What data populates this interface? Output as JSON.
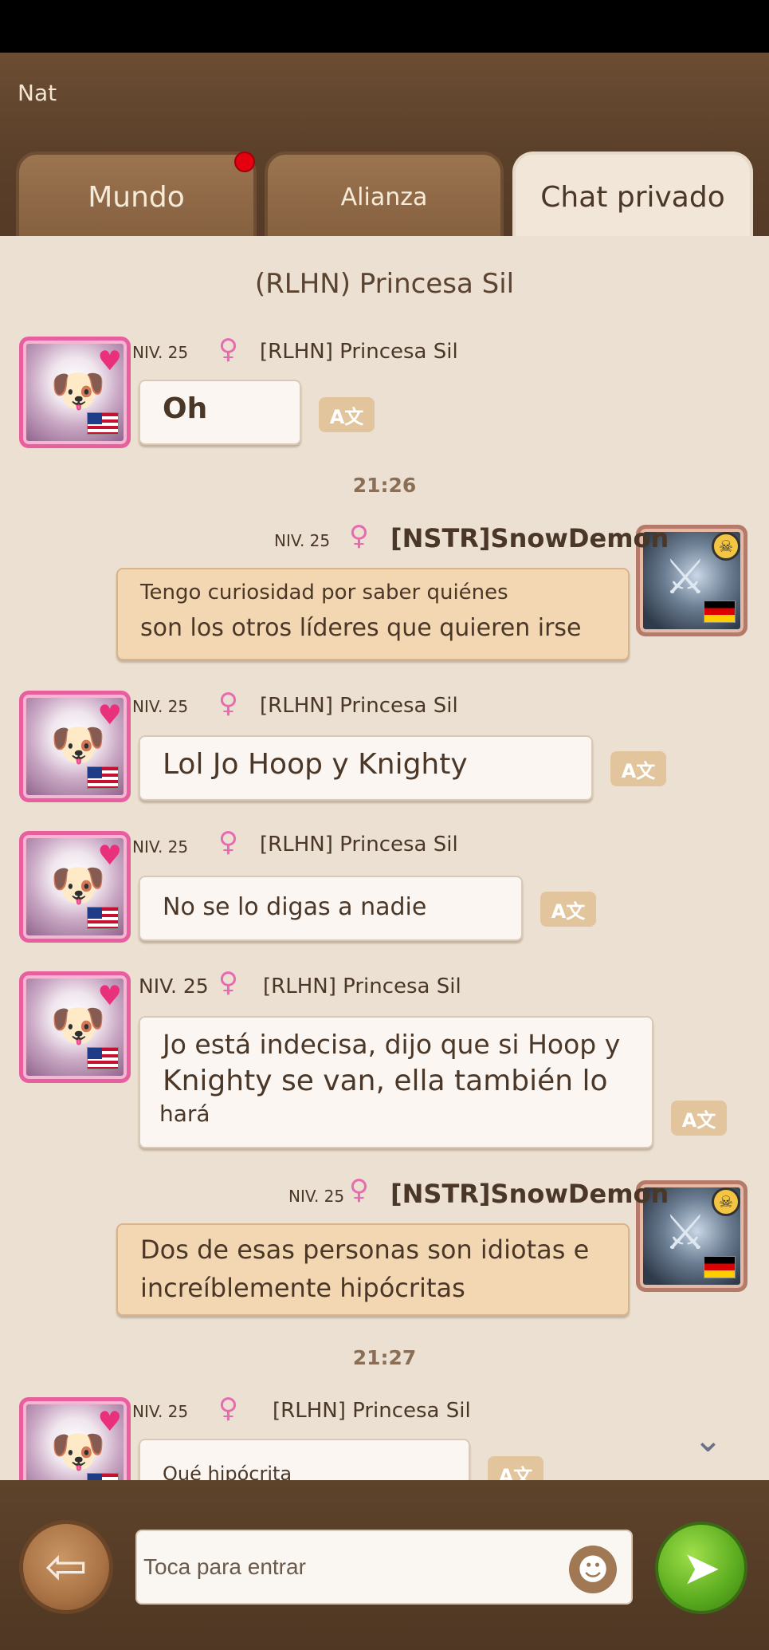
{
  "header": {
    "name": "Nat"
  },
  "tabs": [
    {
      "label": "Mundo",
      "has_notification": true
    },
    {
      "label": "Alianza"
    },
    {
      "label": "Chat privado",
      "active": true
    }
  ],
  "chat": {
    "title": "(RLHN) Princesa Sil",
    "times": [
      "21:26",
      "21:27"
    ],
    "translate_label": "A文",
    "messages": [
      {
        "side": "left",
        "level": "NIV. 25",
        "name": "[RLHN] Princesa Sil",
        "lines": [
          "Oh"
        ]
      },
      {
        "side": "right",
        "level": "NIV. 25",
        "name": "[NSTR]SnowDemon",
        "lines": [
          "Tengo curiosidad por saber quiénes",
          "son los otros líderes que quieren irse"
        ]
      },
      {
        "side": "left",
        "level": "NIV. 25",
        "name": "[RLHN] Princesa Sil",
        "lines": [
          "Lol Jo Hoop y Knighty"
        ]
      },
      {
        "side": "left",
        "level": "NIV. 25",
        "name": "[RLHN] Princesa Sil",
        "lines": [
          "No se lo digas a nadie"
        ]
      },
      {
        "side": "left",
        "level": "NIV. 25",
        "name": "[RLHN] Princesa Sil",
        "lines": [
          "Jo está indecisa, dijo que si Hoop y",
          "Knighty se van, ella también lo",
          "hará"
        ]
      },
      {
        "side": "right",
        "level": "NIV. 25",
        "name": "[NSTR]SnowDemon",
        "lines": [
          "Dos de esas personas son idiotas e",
          "increíblemente hipócritas"
        ]
      },
      {
        "side": "left",
        "level": "NIV. 25",
        "name": "[RLHN] Princesa Sil",
        "lines": [
          "Qué hipócrita"
        ]
      }
    ]
  },
  "footer": {
    "input_placeholder": "Toca para entrar"
  },
  "icons": {
    "female": "female-icon",
    "translate": "translate-icon",
    "back": "back-arrow-icon",
    "emoji": "emoji-icon",
    "send": "send-icon",
    "scroll": "chevron-down-icon"
  },
  "colors": {
    "header_bg": "#5a3f29",
    "chat_bg": "#ebe0d1",
    "bubble_left": "#fbf6f1",
    "bubble_right": "#f3d6b2",
    "notification": "#e4000f",
    "send": "#5aab1f"
  }
}
